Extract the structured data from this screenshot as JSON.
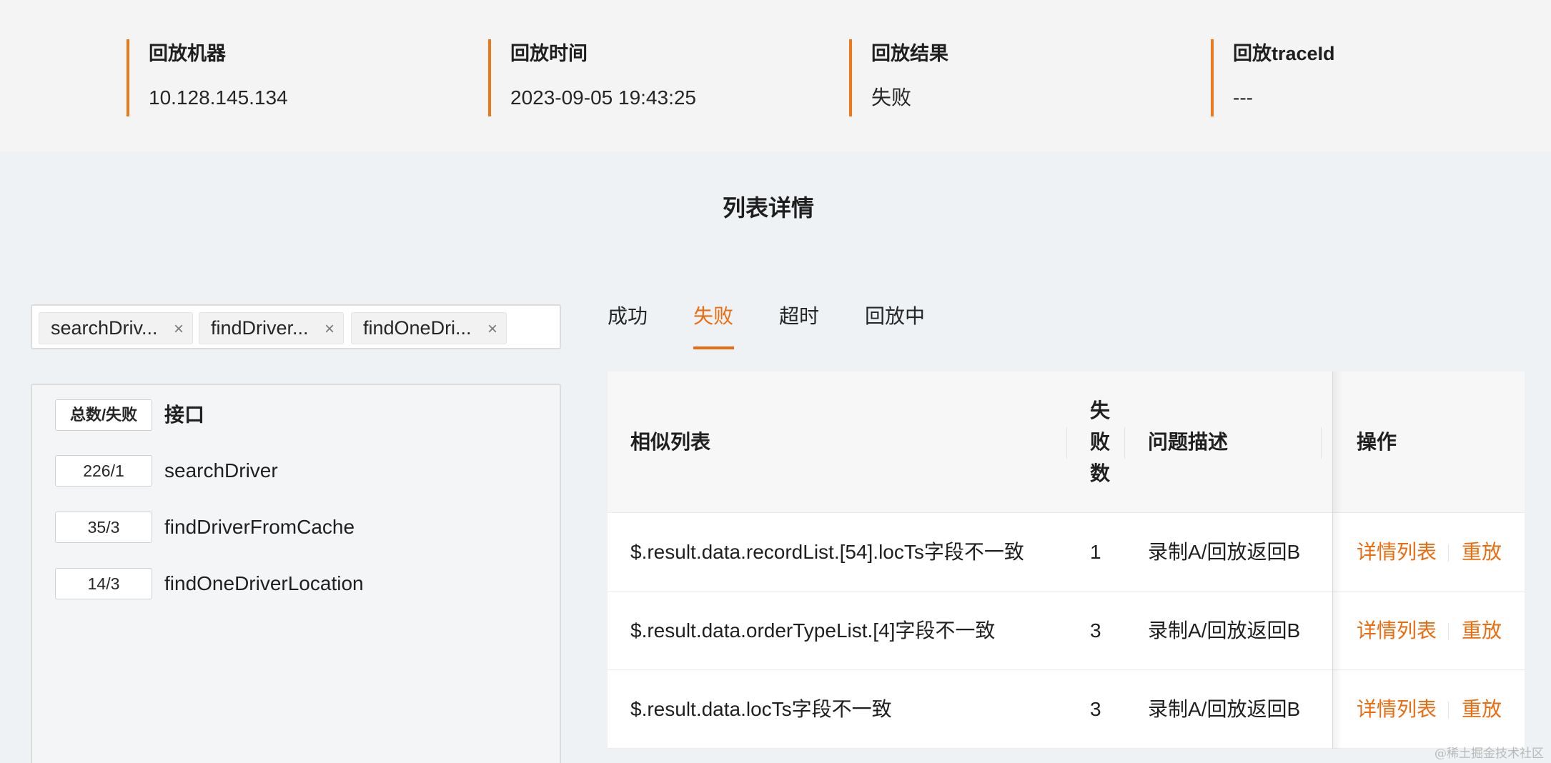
{
  "info": {
    "machine_label": "回放机器",
    "machine_value": "10.128.145.134",
    "time_label": "回放时间",
    "time_value": "2023-09-05 19:43:25",
    "result_label": "回放结果",
    "result_value": "失败",
    "trace_label": "回放traceId",
    "trace_value": "---"
  },
  "section_title": "列表详情",
  "filter_tags": [
    {
      "label": "searchDriv...",
      "close": "×"
    },
    {
      "label": "findDriver...",
      "close": "×"
    },
    {
      "label": "findOneDri...",
      "close": "×"
    }
  ],
  "interfaces": {
    "header_count": "总数/失败",
    "header_name": "接口",
    "items": [
      {
        "count": "226/1",
        "name": "searchDriver"
      },
      {
        "count": "35/3",
        "name": "findDriverFromCache"
      },
      {
        "count": "14/3",
        "name": "findOneDriverLocation"
      }
    ]
  },
  "tabs": [
    {
      "label": "成功"
    },
    {
      "label": "失败",
      "active": true
    },
    {
      "label": "超时"
    },
    {
      "label": "回放中"
    }
  ],
  "table": {
    "headers": {
      "similar": "相似列表",
      "fail_count_1": "失",
      "fail_count_2": "败",
      "fail_count_3": "数",
      "desc": "问题描述",
      "ops": "操作"
    },
    "rows": [
      {
        "similar": "$.result.data.recordList.[54].locTs字段不一致",
        "count": "1",
        "desc": "录制A/回放返回B",
        "detail": "详情列表",
        "replay": "重放"
      },
      {
        "similar": "$.result.data.orderTypeList.[4]字段不一致",
        "count": "3",
        "desc": "录制A/回放返回B",
        "detail": "详情列表",
        "replay": "重放"
      },
      {
        "similar": "$.result.data.locTs字段不一致",
        "count": "3",
        "desc": "录制A/回放返回B",
        "detail": "详情列表",
        "replay": "重放"
      }
    ]
  },
  "watermark": "@稀土掘金技术社区",
  "colors": {
    "accent": "#ec6b0e",
    "border_accent": "#ec7a1c"
  }
}
